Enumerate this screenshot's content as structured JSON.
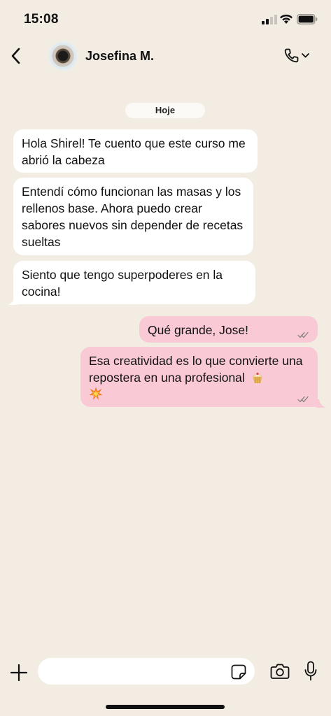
{
  "status_bar": {
    "time": "15:08"
  },
  "header": {
    "contact_name": "Josefina M."
  },
  "date_separator": "Hoje",
  "messages": [
    {
      "direction": "incoming",
      "text": "Hola Shirel! Te cuento que este curso me abrió la cabeza"
    },
    {
      "direction": "incoming",
      "text": "Entendí cómo funcionan las masas y los rellenos base. Ahora puedo crear sabores nuevos sin depender de recetas sueltas"
    },
    {
      "direction": "incoming",
      "text": "Siento que tengo superpoderes en la cocina!"
    },
    {
      "direction": "outgoing",
      "text": "Qué grande, Jose!",
      "status": "read"
    },
    {
      "direction": "outgoing",
      "text": "Esa creatividad es lo que convierte una repostera en una profesional",
      "emojis": [
        "cupcake-emoji",
        "collision-emoji"
      ],
      "status": "read"
    }
  ],
  "composer": {
    "placeholder": ""
  },
  "colors": {
    "background": "#f2ece3",
    "incoming_bubble": "#ffffff",
    "outgoing_bubble": "#f9c9d5",
    "read_ticks": "#7a7a7a"
  }
}
